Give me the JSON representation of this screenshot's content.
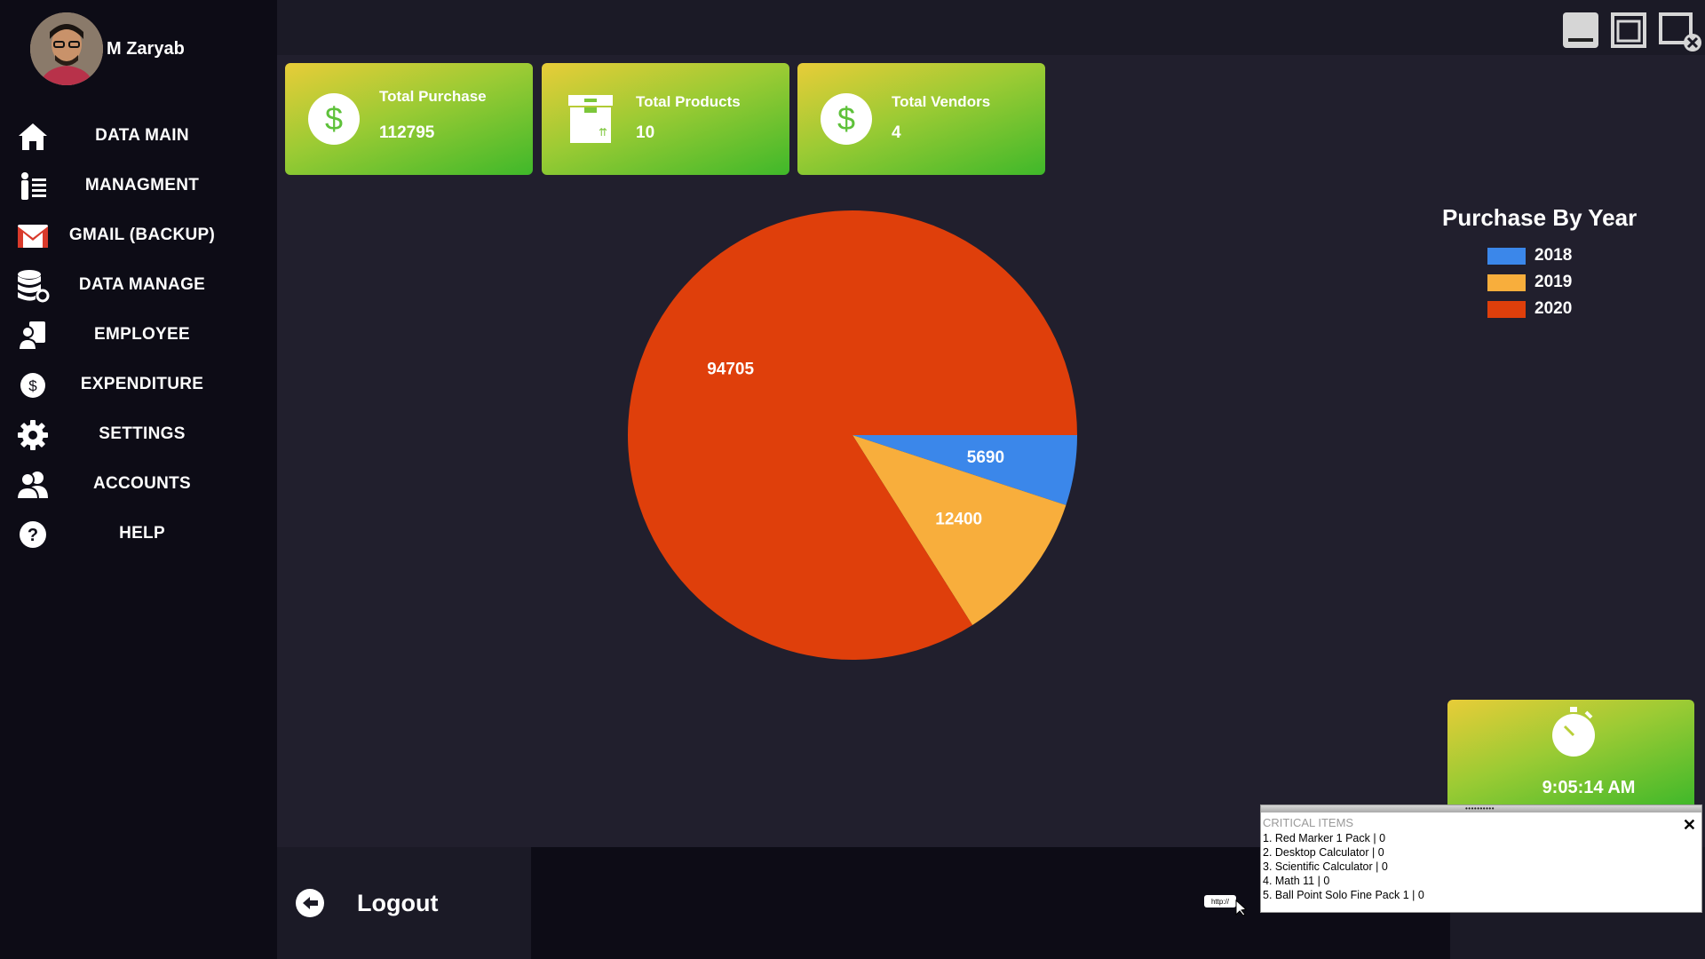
{
  "user": {
    "name": "M Zaryab"
  },
  "nav": [
    {
      "label": "DATA MAIN",
      "icon": "home-icon"
    },
    {
      "label": "MANAGMENT",
      "icon": "management-icon"
    },
    {
      "label": "GMAIL (BACKUP)",
      "icon": "gmail-icon"
    },
    {
      "label": "DATA MANAGE",
      "icon": "database-icon"
    },
    {
      "label": "EMPLOYEE",
      "icon": "employee-icon"
    },
    {
      "label": "EXPENDITURE",
      "icon": "dollar-coin-icon"
    },
    {
      "label": "SETTINGS",
      "icon": "gear-icon"
    },
    {
      "label": "ACCOUNTS",
      "icon": "users-icon"
    },
    {
      "label": "HELP",
      "icon": "help-icon"
    }
  ],
  "cards": [
    {
      "title": "Total Purchase",
      "value": "112795",
      "icon": "dollar-icon"
    },
    {
      "title": "Total Products",
      "value": "10",
      "icon": "box-icon"
    },
    {
      "title": "Total Vendors",
      "value": "4",
      "icon": "dollar-icon"
    }
  ],
  "chart_data": {
    "type": "pie",
    "title": "Purchase By Year",
    "categories": [
      "2018",
      "2019",
      "2020"
    ],
    "values": [
      5690,
      12400,
      94705
    ],
    "colors": [
      "#3b87ea",
      "#f8ae3c",
      "#df3f0b"
    ],
    "data_labels": [
      "5690",
      "12400",
      "94705"
    ],
    "legend_position": "right"
  },
  "clock": {
    "time": "9:05:14 AM"
  },
  "logout": {
    "label": "Logout"
  },
  "critical": {
    "title": "CRITICAL ITEMS",
    "close": "✕",
    "items": [
      "1. Red Marker 1 Pack | 0",
      "2. Desktop Calculator | 0",
      "3. Scientific Calculator | 0",
      "4. Math 11 | 0",
      "5. Ball Point Solo Fine Pack 1 | 0"
    ]
  },
  "colors": {
    "accent_green": "#3fb82a",
    "accent_yellow": "#e8cc38",
    "panel": "#211f2d",
    "sidebar": "#0d0c16"
  }
}
